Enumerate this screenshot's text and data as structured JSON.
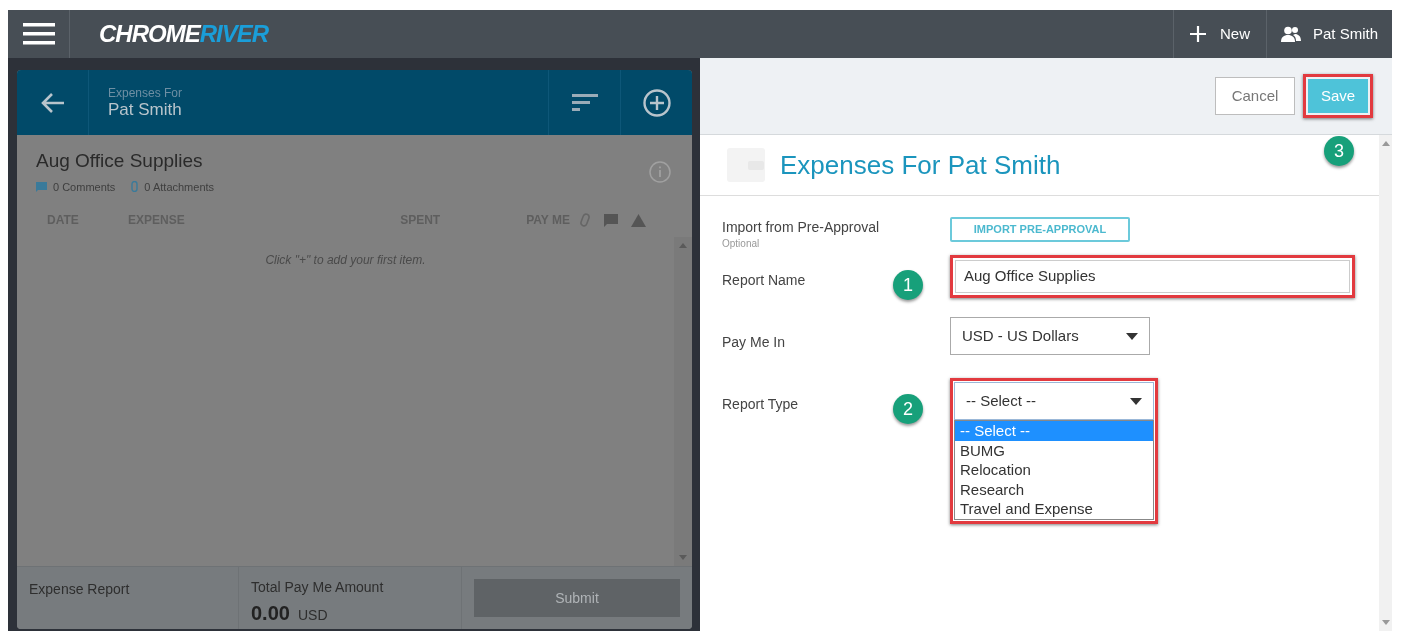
{
  "top_bar": {
    "logo": [
      "CHROME",
      "RIVER"
    ],
    "new_button": "New",
    "user": "Pat Smith"
  },
  "report_panel": {
    "header": {
      "caption": "Expenses For",
      "name": "Pat Smith"
    },
    "report": {
      "title": "Aug Office Supplies",
      "comments": "0 Comments",
      "attachments": "0 Attachments"
    },
    "columns": [
      "DATE",
      "EXPENSE",
      "SPENT",
      "PAY ME"
    ],
    "empty_message": "Click \"+\" to add your first item.",
    "footer": {
      "type_label": "Expense Report",
      "total_label": "Total Pay Me Amount",
      "total_value": "0.00",
      "currency": "USD",
      "submit": {
        "label": "Submit",
        "disabled": true
      }
    }
  },
  "form_panel": {
    "cancel": "Cancel",
    "save": "Save",
    "title": "Expenses For Pat Smith",
    "fields": [
      {
        "kind": "button",
        "label": "Import from Pre-Approval",
        "hint": "Optional",
        "button": "IMPORT PRE-APPROVAL"
      },
      {
        "kind": "text",
        "label": "Report Name",
        "value": "Aug Office Supplies",
        "step": "1"
      },
      {
        "kind": "select",
        "label": "Pay Me In",
        "value": "USD - US Dollars"
      },
      {
        "kind": "select",
        "label": "Report Type",
        "value": "-- Select --",
        "step": "2",
        "expanded": true,
        "options": [
          {
            "label": "-- Select --",
            "selected": true
          },
          {
            "label": "BUMG",
            "selected": false
          },
          {
            "label": "Relocation",
            "selected": false
          },
          {
            "label": "Research",
            "selected": false
          },
          {
            "label": "Travel and Expense",
            "selected": false
          }
        ]
      }
    ],
    "save_step": "3"
  }
}
